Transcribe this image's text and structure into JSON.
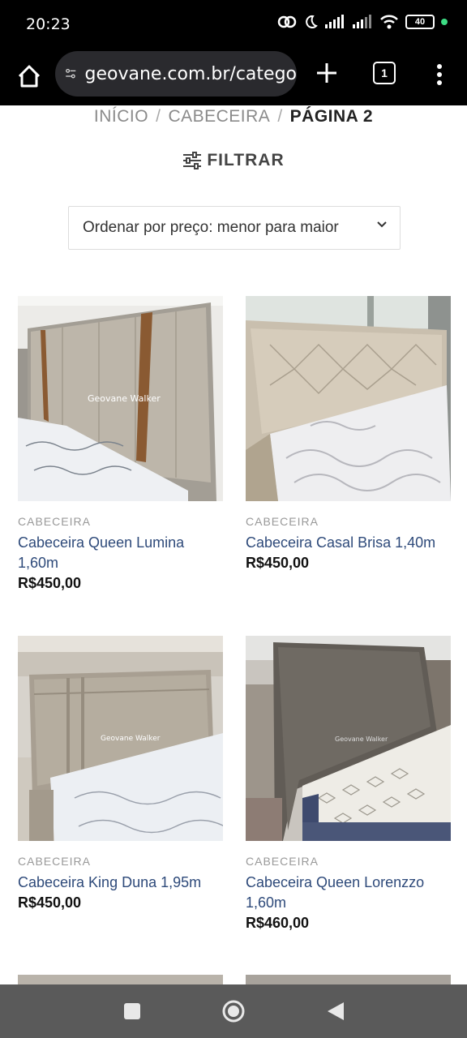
{
  "status_bar": {
    "time": "20:23",
    "battery": "40"
  },
  "browser": {
    "url": "geovane.com.br/catego",
    "tab_count": "1"
  },
  "breadcrumb": {
    "home": "INÍCIO",
    "sep1": "/",
    "category": "CABECEIRA",
    "sep2": "/",
    "current": "PÁGINA 2"
  },
  "filter": {
    "label": "FILTRAR"
  },
  "sort": {
    "label": "Ordenar por preço: menor para maior"
  },
  "products": [
    {
      "category": "CABECEIRA",
      "title": "Cabeceira Queen Lumina 1,60m",
      "price": "R$450,00",
      "watermark": "Geovane Walker"
    },
    {
      "category": "CABECEIRA",
      "title": "Cabeceira Casal Brisa 1,40m",
      "price": "R$450,00",
      "watermark": ""
    },
    {
      "category": "CABECEIRA",
      "title": "Cabeceira King Duna 1,95m",
      "price": "R$450,00",
      "watermark": "Geovane Walker"
    },
    {
      "category": "CABECEIRA",
      "title": "Cabeceira Queen Lorenzzo 1,60m",
      "price": "R$460,00",
      "watermark": "Geovane Walker"
    }
  ],
  "icons": {
    "home": "home-icon",
    "site_settings": "site-settings-icon",
    "new_tab": "plus-icon",
    "tabs": "tabs-icon",
    "menu": "more-vert-icon",
    "filter": "sliders-icon",
    "sort": "chevron-down-icon",
    "nav_recents": "square-icon",
    "nav_home": "circle-icon",
    "nav_back": "triangle-back-icon"
  },
  "colors": {
    "title_link": "#2e4a7a",
    "price": "#111111",
    "category": "#999999",
    "nav_bar": "#5a5a5a"
  }
}
